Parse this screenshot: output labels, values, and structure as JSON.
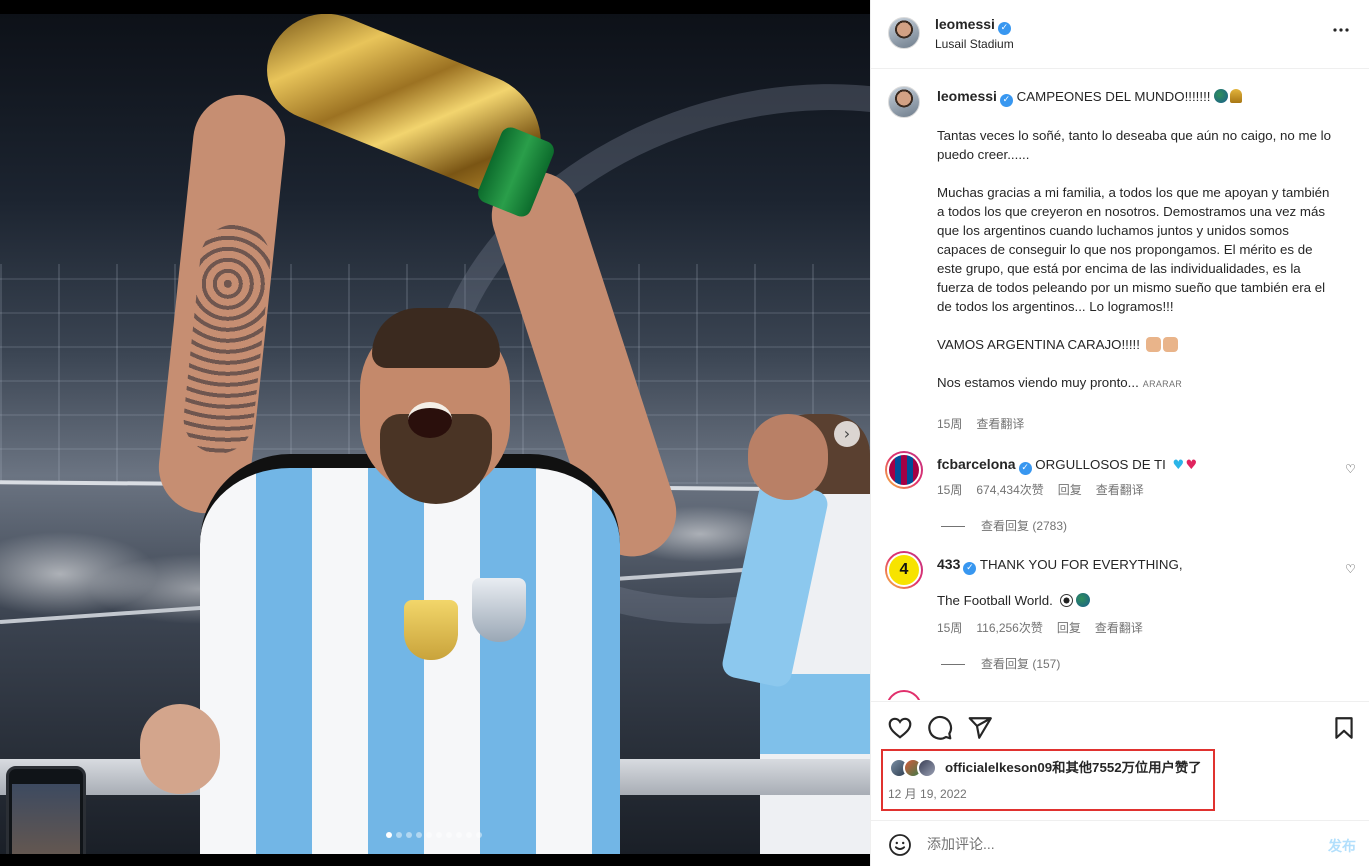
{
  "post": {
    "username": "leomessi",
    "location": "Lusail Stadium",
    "more_icon": "more-horizontal-icon",
    "caption_headline": "CAMPEONES DEL MUNDO!!!!!!!",
    "caption_body": "Tantas veces lo soñé, tanto lo deseaba que aún no caigo, no me lo puedo creer......\n\nMuchas gracias a mi familia, a todos los que me apoyan y también a todos los que creyeron en nosotros. Demostramos una vez más que los argentinos cuando luchamos juntos y unidos somos capaces de conseguir lo que nos propongamos. El mérito es de este grupo, que está por encima de las individualidades, es la fuerza de todos peleando por un mismo sueño que también era el de todos los argentinos... Lo logramos!!!\n\nVAMOS ARGENTINA CARAJO!!!!!",
    "caption_last": "Nos estamos viendo muy pronto...",
    "caption_more": "ARARAR",
    "time": "15周",
    "translate": "查看翻译",
    "likes_text": "officialelkeson09和其他7552万位用户赞了",
    "date": "12 月 19, 2022",
    "carousel": {
      "current": 1,
      "total": 10
    }
  },
  "comments": [
    {
      "username": "fcbarcelona",
      "verified": true,
      "text": "ORGULLOSOS DE TI",
      "time": "15周",
      "likes": "674,434次赞",
      "reply": "回复",
      "translate": "查看翻译",
      "view_replies": "查看回复 (2783)"
    },
    {
      "username": "433",
      "verified": true,
      "text": "THANK YOU FOR EVERYTHING,",
      "text2": "The Football World.",
      "time": "15周",
      "likes": "116,256次赞",
      "reply": "回复",
      "translate": "查看翻译",
      "view_replies": "查看回复 (157)"
    }
  ],
  "add_comment": {
    "placeholder": "添加评论...",
    "post_label": "发布"
  },
  "colors": {
    "verified": "#3897f0",
    "highlight_box": "#e0322f",
    "post_button_disabled": "#b2dffc"
  }
}
